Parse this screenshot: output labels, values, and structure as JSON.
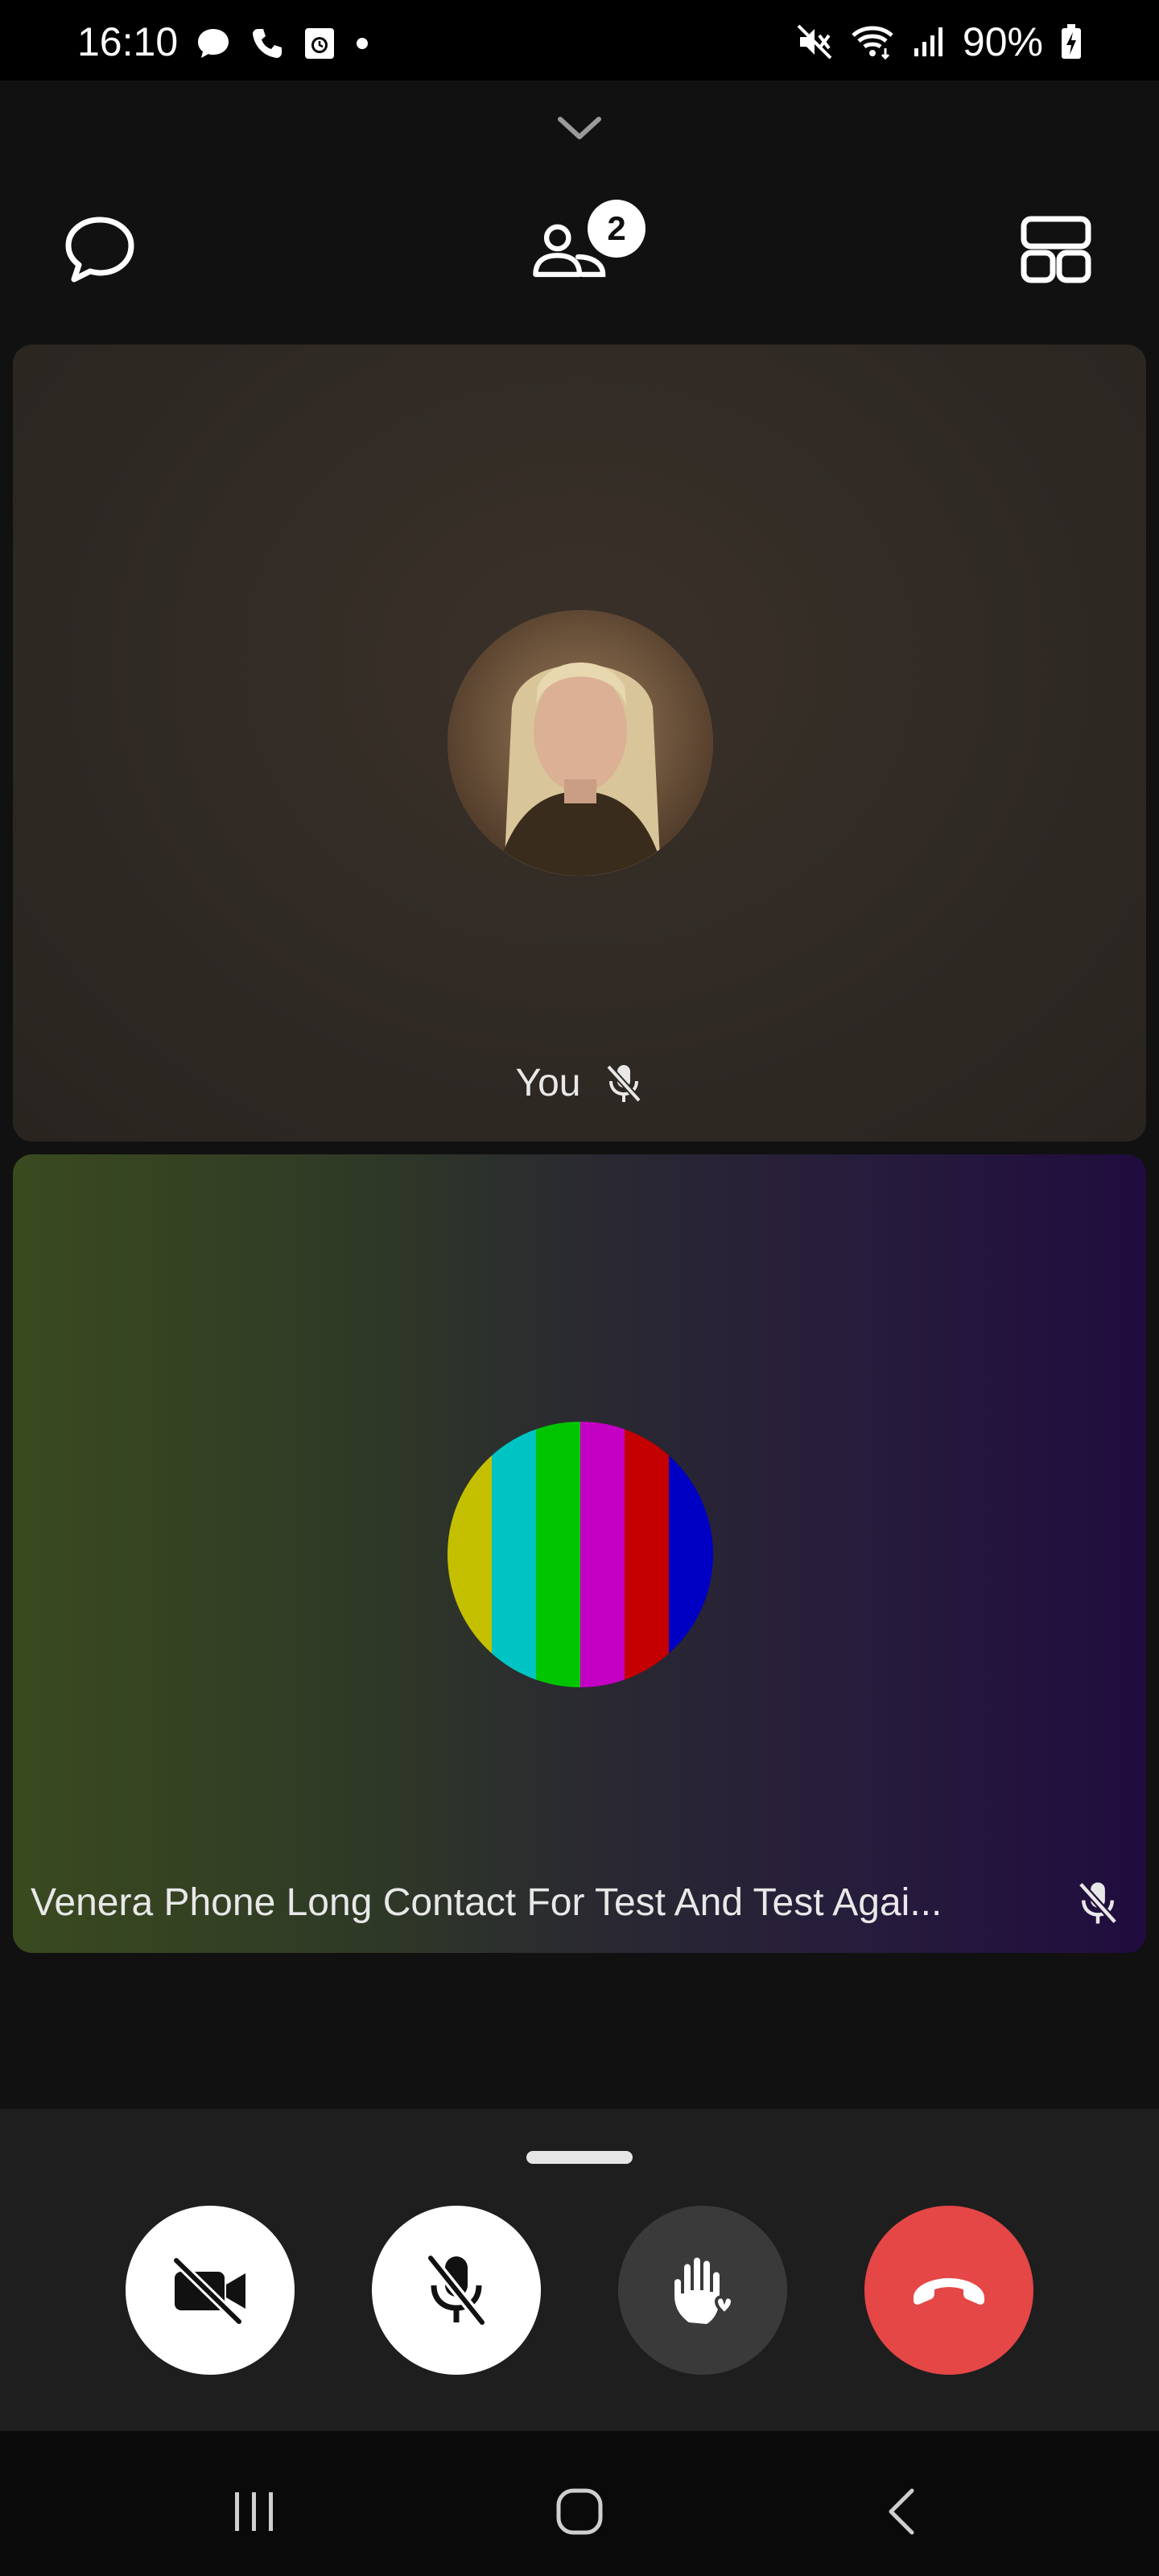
{
  "status_bar": {
    "time": "16:10",
    "battery": "90%",
    "left_icons": [
      "chat-bubble-icon",
      "phone-icon",
      "clock-app-icon",
      "dot-icon"
    ],
    "right_icons": [
      "mute-icon",
      "wifi-icon",
      "signal-icon",
      "battery-charging-icon"
    ]
  },
  "call": {
    "participants_count": "2",
    "tiles": [
      {
        "name": "You",
        "muted": true
      },
      {
        "name": "Venera Phone Long Contact For Test And Test Agai...",
        "muted": true,
        "avatar_stripes": [
          "#c4c000",
          "#00c4c4",
          "#00c400",
          "#c400c4",
          "#c40000",
          "#0000c4"
        ]
      }
    ]
  },
  "controls": {
    "camera": "camera-off",
    "microphone": "microphone-off",
    "reactions": "raise-hand",
    "end_call": "end-call",
    "end_call_color": "#e54646"
  },
  "nav": [
    "recent-apps",
    "home",
    "back"
  ]
}
